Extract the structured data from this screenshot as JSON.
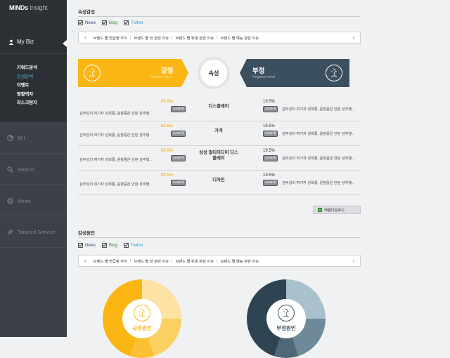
{
  "app": {
    "logo_bold": "MINDs",
    "logo_light": " Insight"
  },
  "sidebar": {
    "biz_label": "My Biz",
    "submenu": [
      "키워드분석",
      "감성분석",
      "이벤트",
      "영향력자",
      "리스크탐지"
    ],
    "active_index": 1,
    "nav": [
      {
        "label": "M.I.",
        "icon": "chart-icon"
      },
      {
        "label": "Search",
        "icon": "search-icon"
      },
      {
        "label": "News",
        "icon": "globe-icon"
      },
      {
        "label": "Tailored Service",
        "icon": "link-icon"
      }
    ]
  },
  "section1": {
    "title": "속성감성",
    "checkboxes": [
      "News",
      "Blog",
      "Twitter"
    ],
    "tabs": [
      "브랜드 별 연급량 추이",
      "브랜드 별 핫 관련 이슈",
      "브랜드 별 위생 관련 이슈",
      "브랜드 별 예능 관련 이슈"
    ],
    "positive": {
      "title": "긍정",
      "subtitle": "Positive mind",
      "color": "#fbb614"
    },
    "negative": {
      "title": "부정",
      "subtitle": "Negative mind",
      "color": "#3c4f5e"
    },
    "center_label": "속성",
    "rows": [
      {
        "attr": "디스플레이",
        "pos_pct": "80.5%",
        "pos_cnt": "2445개",
        "pos_text": "김무성의 여기자 성희롱, 윤창중은 안된 성추행..",
        "neg_pct": "19.5%",
        "neg_cnt": "2445개",
        "neg_text": "김무성의 여기자 성희롱, 윤창중은 안된 성추행.."
      },
      {
        "attr": "가격",
        "pos_pct": "80.5%",
        "pos_cnt": "2445개",
        "pos_text": "김무성의 여기자 성희롱, 윤창중은 안된 성추행..",
        "neg_pct": "19.5%",
        "neg_cnt": "2445개",
        "neg_text": "김무성의 여기자 성희롱, 윤창중은 안된 성추행.."
      },
      {
        "attr": "삼성 멀티미디어 디스플레이",
        "pos_pct": "80.5%",
        "pos_cnt": "2445개",
        "pos_text": "김무성의 여기자 성희롱, 윤창중은 안된 성추행..",
        "neg_pct": "19.5%",
        "neg_cnt": "2445개",
        "neg_text": "김무성의 여기자 성희롱, 윤창중은 안된 성추행.."
      },
      {
        "attr": "디자인",
        "pos_pct": "80.5%",
        "pos_cnt": "2445개",
        "pos_text": "김무성의 여기자 성희롱, 윤창중은 안된 성추행..",
        "neg_pct": "19.5%",
        "neg_cnt": "2445개",
        "neg_text": "김무성의 여기자 성희롱, 윤창중은 안된 성추행.."
      }
    ],
    "excel_label": "엑셀다운로드",
    "more": "···"
  },
  "section2": {
    "title": "감성원인",
    "checkboxes": [
      "News",
      "Blog",
      "Twitter"
    ],
    "tabs": [
      "브랜드 별 연급량 추이",
      "브랜드 별 핫 관련 이슈",
      "브랜드 별 위생 관련 이슈",
      "브랜드 별 예능 관련 이슈"
    ],
    "positive_label": "긍정원인",
    "negative_label": "부정원인"
  }
}
